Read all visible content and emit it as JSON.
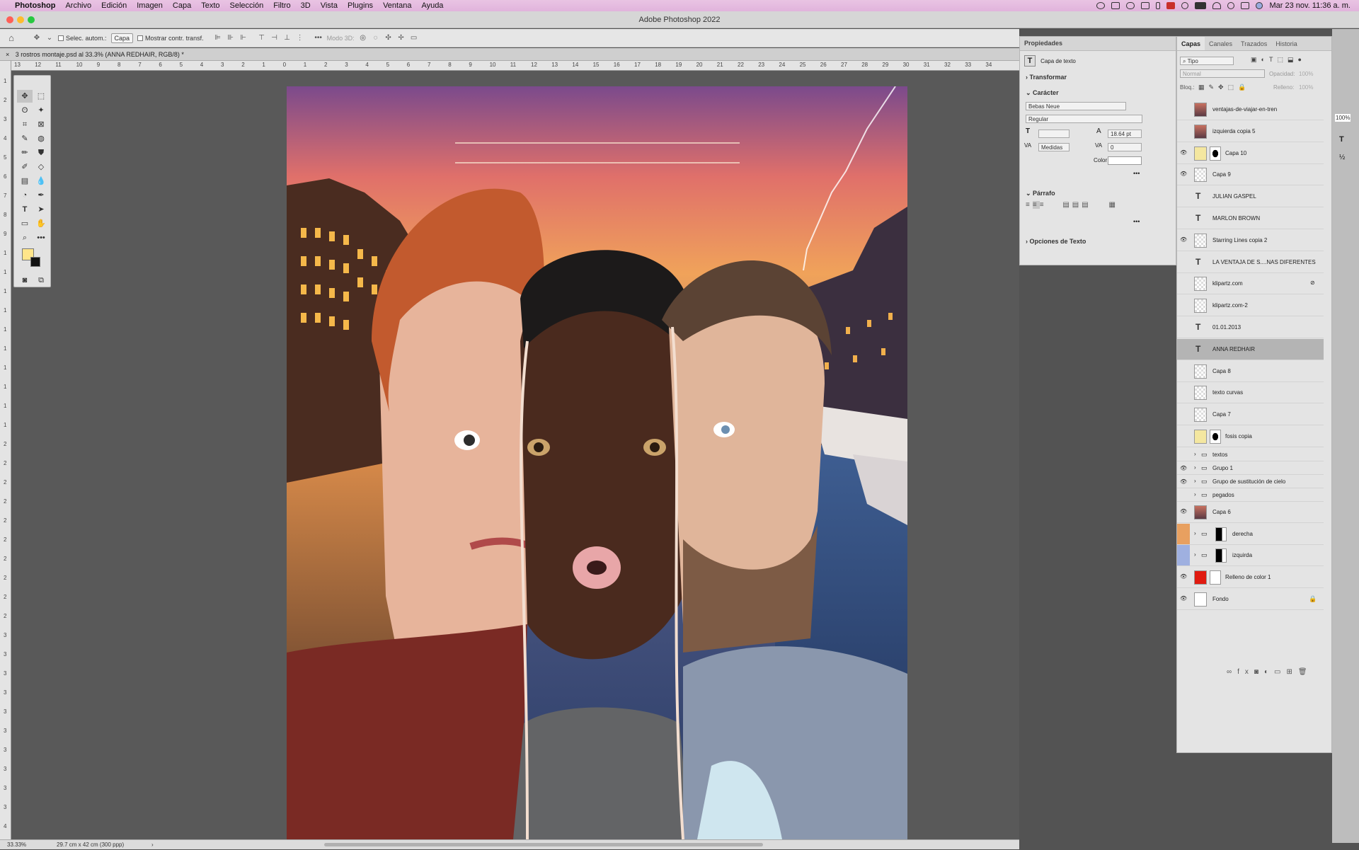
{
  "menubar": {
    "app": "Photoshop",
    "items": [
      "Archivo",
      "Edición",
      "Imagen",
      "Capa",
      "Texto",
      "Selección",
      "Filtro",
      "3D",
      "Vista",
      "Plugins",
      "Ventana",
      "Ayuda"
    ],
    "clock": "Mar 23 nov.  11:36 a. m."
  },
  "window": {
    "title": "Adobe Photoshop 2022"
  },
  "options": {
    "auto_select_label": "Selec. autom.:",
    "auto_select_value": "Capa",
    "show_transform_label": "Mostrar contr. transf.",
    "mode3d_label": "Modo 3D:"
  },
  "document": {
    "tab_title": "3 rostros montaje.psd al 33.3% (ANNA REDHAIR, RGB/8) *",
    "zoom": "33.33%",
    "doc_size": "29.7 cm x 42 cm (300 ppp)"
  },
  "rulers": {
    "h_ticks": [
      "13",
      "12",
      "11",
      "10",
      "9",
      "8",
      "7",
      "6",
      "5",
      "4",
      "3",
      "2",
      "1",
      "0",
      "1",
      "2",
      "3",
      "4",
      "5",
      "6",
      "7",
      "8",
      "9",
      "10",
      "11",
      "12",
      "13",
      "14",
      "15",
      "16",
      "17",
      "18",
      "19",
      "20",
      "21",
      "22",
      "23",
      "24",
      "25",
      "26",
      "27",
      "28",
      "29",
      "30",
      "31",
      "32",
      "33",
      "34"
    ],
    "v_ticks": [
      "1",
      "2",
      "3",
      "4",
      "5",
      "6",
      "7",
      "8",
      "9",
      "1",
      "1",
      "1",
      "1",
      "1",
      "1",
      "1",
      "1",
      "1",
      "1",
      "2",
      "2",
      "2",
      "2",
      "2",
      "2",
      "2",
      "2",
      "2",
      "2",
      "3",
      "3",
      "3",
      "3",
      "3",
      "3",
      "3",
      "3",
      "3",
      "3",
      "4"
    ]
  },
  "properties": {
    "tab": "Propiedades",
    "layer_kind": "Capa de texto",
    "transform": "Transformar",
    "character": "Carácter",
    "font_family": "Bebas Neue",
    "font_style": "Regular",
    "font_size": "",
    "leading": "18.64 pt",
    "kerning": "Medidas",
    "tracking": "0",
    "color_label": "Color",
    "paragraph": "Párrafo",
    "text_options": "Opciones de Texto"
  },
  "layers_panel": {
    "tabs": [
      "Capas",
      "Canales",
      "Trazados",
      "Historia"
    ],
    "filter": "Tipo",
    "blend_mode": "Normal",
    "opacity_label": "Opacidad:",
    "opacity_value": "100%",
    "lock_label": "Bloq.:",
    "fill_label": "Relleno:",
    "fill_value": "100%",
    "layers": [
      {
        "name": "ventajas-de-viajar-en-tren",
        "kind": "image",
        "visible": false
      },
      {
        "name": "izquierda copia 5",
        "kind": "image",
        "visible": false
      },
      {
        "name": "Capa 10",
        "kind": "masked",
        "visible": true
      },
      {
        "name": "Capa 9",
        "kind": "pixel",
        "visible": true
      },
      {
        "name": "JULIAN GASPEL",
        "kind": "text",
        "visible": false
      },
      {
        "name": "MARLON BROWN",
        "kind": "text",
        "visible": false
      },
      {
        "name": "Starring Lines copia 2",
        "kind": "pixel",
        "visible": true
      },
      {
        "name": "LA VENTAJA DE S....NAS DIFERENTES",
        "kind": "text",
        "visible": false
      },
      {
        "name": "klipartz.com",
        "kind": "smart",
        "visible": false
      },
      {
        "name": "klipartz.com-2",
        "kind": "smart",
        "visible": false
      },
      {
        "name": "01.01.2013",
        "kind": "text",
        "visible": false
      },
      {
        "name": "ANNA REDHAIR",
        "kind": "text",
        "visible": false,
        "selected": true
      },
      {
        "name": "Capa 8",
        "kind": "pixel",
        "visible": false
      },
      {
        "name": "texto curvas",
        "kind": "pixel",
        "visible": false
      },
      {
        "name": "Capa 7",
        "kind": "pixel",
        "visible": false
      },
      {
        "name": "fosis copia",
        "kind": "masked",
        "visible": false
      },
      {
        "name": "textos",
        "kind": "group",
        "visible": false
      },
      {
        "name": "Grupo 1",
        "kind": "group",
        "visible": true
      },
      {
        "name": "Grupo de sustitución de cielo",
        "kind": "group",
        "visible": true
      },
      {
        "name": "pegados",
        "kind": "group",
        "visible": false
      },
      {
        "name": "Capa 6",
        "kind": "image",
        "visible": true
      },
      {
        "name": "derecha",
        "kind": "group-mask",
        "visible": false,
        "tag": "#e8a060"
      },
      {
        "name": "izquirda",
        "kind": "group-mask",
        "visible": false,
        "tag": "#9fb0e0"
      },
      {
        "name": "Relleno de color 1",
        "kind": "fill",
        "visible": true
      },
      {
        "name": "Fondo",
        "kind": "background",
        "visible": true
      }
    ]
  },
  "colors": {
    "foreground": "#ffe58a",
    "background": "#111111",
    "selected_layer": "#b4b4b4",
    "fill_swatch": "#e01a10"
  },
  "right_strip": {
    "opacity_hint": "100%"
  }
}
